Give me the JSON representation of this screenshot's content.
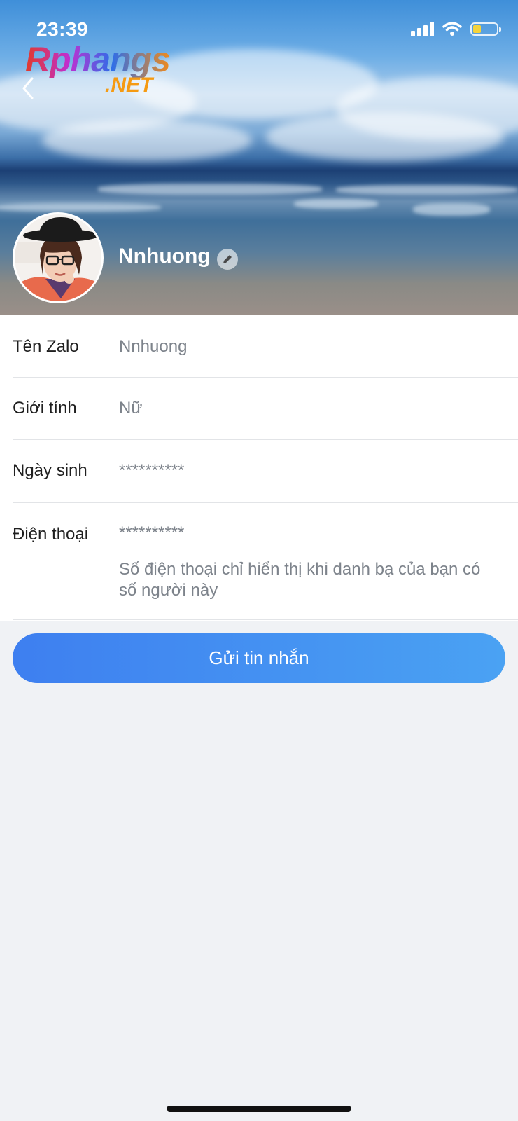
{
  "status_bar": {
    "time": "23:39",
    "battery_level": 0.35,
    "battery_color": "#f5d33b",
    "signal_icon": "cellular-signal-icon",
    "wifi_icon": "wifi-icon",
    "battery_icon": "battery-icon"
  },
  "watermark": {
    "main": "Rphangs",
    "sub": ".NET"
  },
  "header": {
    "back_icon": "chevron-left-icon",
    "profile_name": "Nnhuong",
    "edit_icon": "pencil-icon"
  },
  "info": {
    "rows": [
      {
        "label": "Tên Zalo",
        "value": "Nnhuong"
      },
      {
        "label": "Giới tính",
        "value": "Nữ"
      },
      {
        "label": "Ngày sinh",
        "value": "**********"
      },
      {
        "label": "Điện thoại",
        "value": "**********",
        "note": "Số điện thoại chỉ hiển thị khi danh bạ của bạn có số người này"
      }
    ]
  },
  "actions": {
    "send_message_label": "Gửi tin nhắn"
  },
  "colors": {
    "accent_start": "#3e7ff0",
    "accent_end": "#4aa2f3",
    "page_bg": "#f0f2f5"
  }
}
